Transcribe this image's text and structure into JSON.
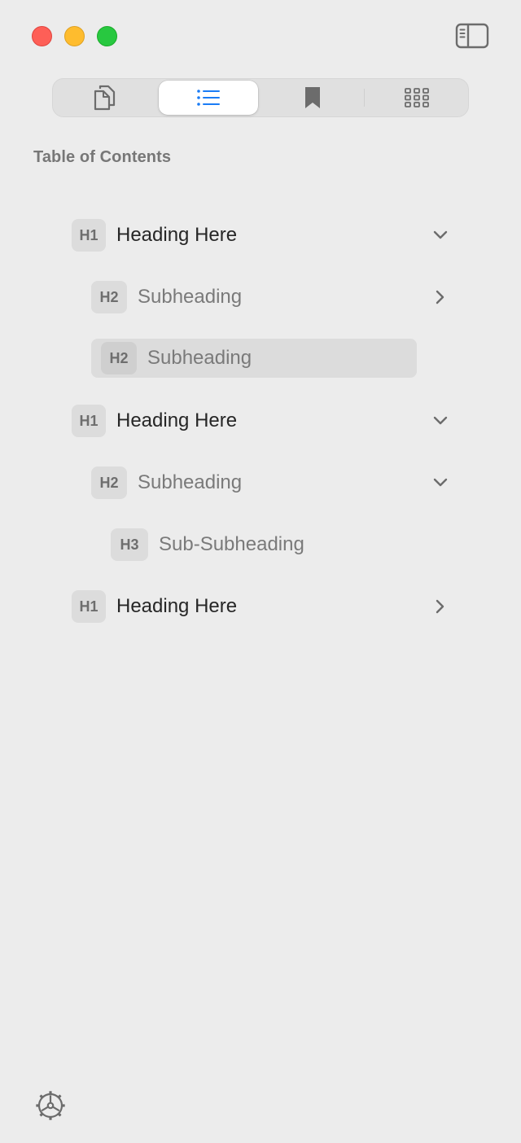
{
  "window": {
    "controls": [
      "close",
      "minimize",
      "zoom"
    ]
  },
  "toolbar": {
    "sidebar_toggle_icon": "sidebar-left-icon",
    "segments": [
      {
        "icon": "documents-icon",
        "active": false
      },
      {
        "icon": "list-bullet-icon",
        "active": true
      },
      {
        "icon": "bookmark-icon",
        "active": false
      },
      {
        "icon": "grid-icon",
        "active": false
      }
    ],
    "accent_color": "#1a7cf5"
  },
  "toc": {
    "title": "Table of Contents",
    "items": [
      {
        "level": "H1",
        "label": "Heading Here",
        "chevron": "down",
        "selected": false
      },
      {
        "level": "H2",
        "label": "Subheading",
        "chevron": "right",
        "selected": false
      },
      {
        "level": "H2",
        "label": "Subheading",
        "chevron": "none",
        "selected": true
      },
      {
        "level": "H1",
        "label": "Heading Here",
        "chevron": "down",
        "selected": false
      },
      {
        "level": "H2",
        "label": "Subheading",
        "chevron": "down",
        "selected": false
      },
      {
        "level": "H3",
        "label": "Sub-Subheading",
        "chevron": "none",
        "selected": false
      },
      {
        "level": "H1",
        "label": "Heading Here",
        "chevron": "right",
        "selected": false
      }
    ]
  },
  "footer": {
    "settings_icon": "gear-icon"
  }
}
